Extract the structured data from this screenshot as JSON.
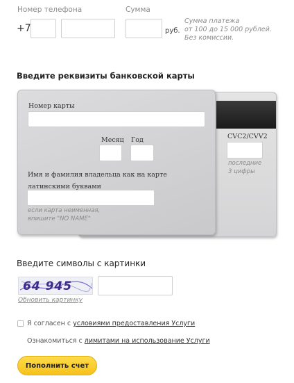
{
  "top": {
    "phone_label": "Номер телефона",
    "phone_prefix": "+7",
    "sum_label": "Сумма",
    "currency": "руб.",
    "sum_note_1": "Сумма платежа",
    "sum_note_2": "от 100 до 15 000 рублей.",
    "sum_note_3": "Без комиссии."
  },
  "card_section": {
    "title": "Введите реквизиты банковской карты",
    "card_number_label": "Номер карты",
    "month_label": "Месяц",
    "year_label": "Год",
    "holder_label_1": "Имя и фамилия владельца как на карте",
    "holder_label_2": "латинскими буквами",
    "holder_note_1": "если карта неименная,",
    "holder_note_2": "впишите \"NO NAME\"",
    "cvc_label": "CVC2/CVV2",
    "cvc_note_1": "последние",
    "cvc_note_2": "3 цифры"
  },
  "captcha": {
    "title": "Введите символы с картинки",
    "image_text": "64 945",
    "refresh_link": "Обновить картинку"
  },
  "agreement": {
    "checkbox_prefix": "Я согласен с ",
    "checkbox_link": "условиями предоставления Услуги",
    "limits_prefix": "Ознакомиться с ",
    "limits_link": "лимитами на использование Услуги"
  },
  "submit_label": "Пополнить счет",
  "colors": {
    "button": "#f6c21c",
    "card": "#d4d4d6",
    "stripe": "#1a1a1a"
  }
}
